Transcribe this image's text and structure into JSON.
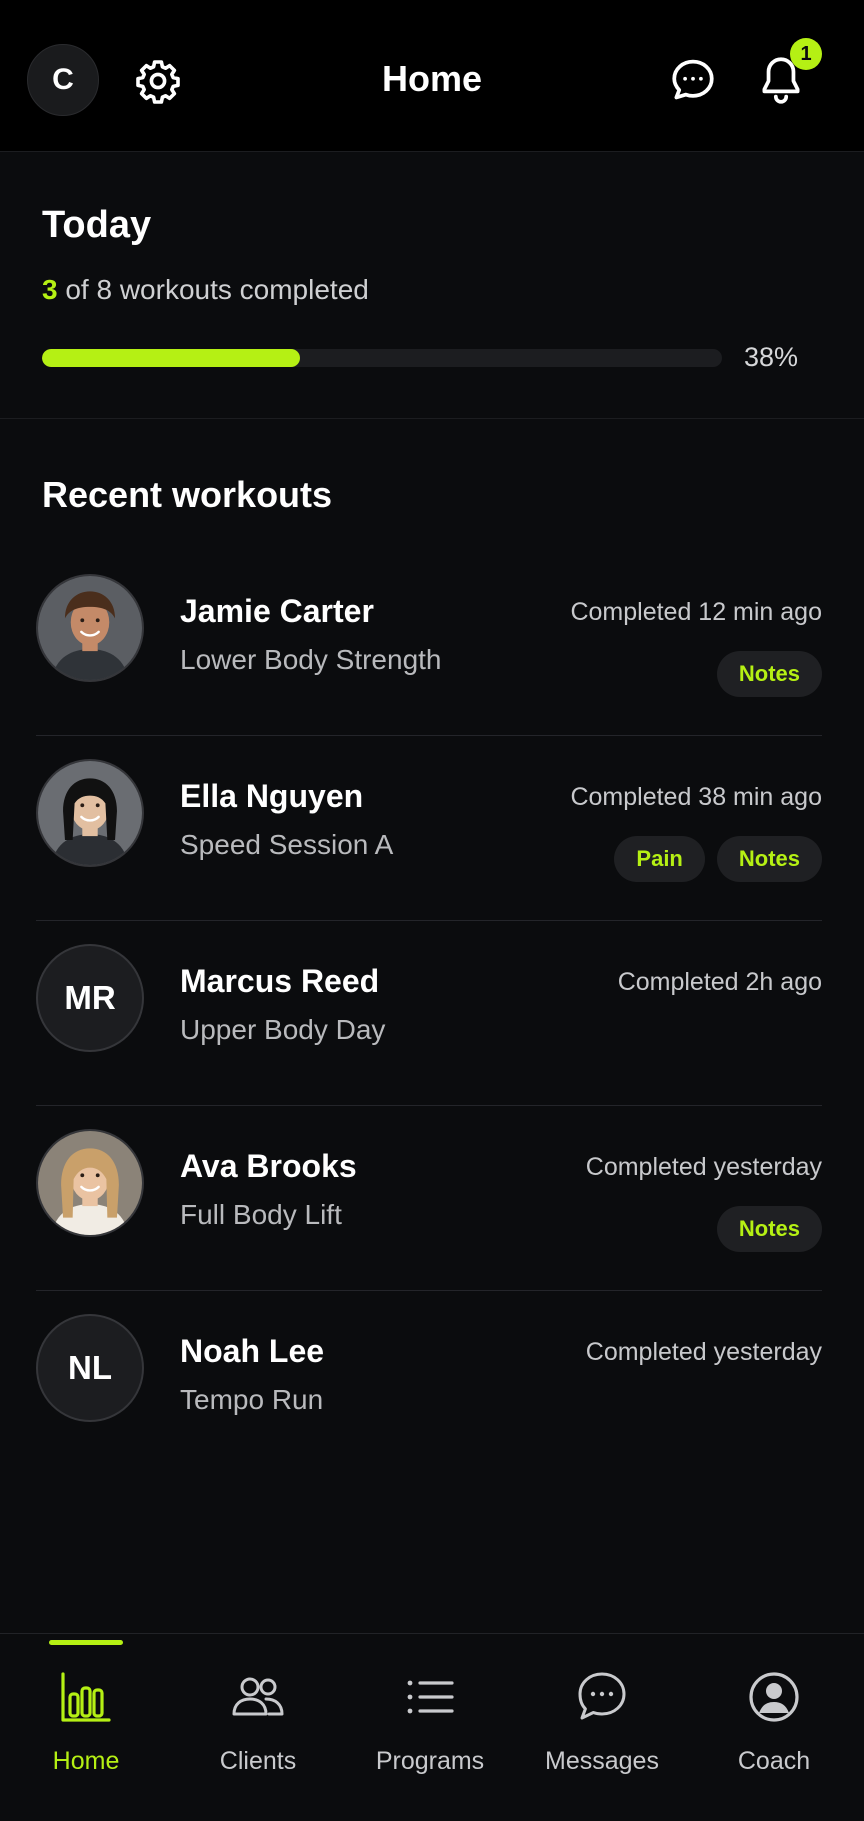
{
  "header": {
    "avatar_initial": "C",
    "title": "Home",
    "notification_count": "1",
    "icons": {
      "settings": "gear-icon",
      "messages": "chat-bubble-icon",
      "notifications": "bell-icon"
    }
  },
  "today": {
    "title": "Today",
    "completed": "3",
    "summary_suffix": " of 8 workouts completed",
    "total": 8,
    "progress_fraction": 0.38,
    "percent_label": "38%"
  },
  "recent": {
    "title": "Recent workouts",
    "items": [
      {
        "name": "Jamie Carter",
        "program": "Lower Body Strength",
        "time": "Completed 12 min ago",
        "avatar": "photo",
        "tags": [
          "Notes"
        ]
      },
      {
        "name": "Ella Nguyen",
        "program": "Speed Session A",
        "time": "Completed 38 min ago",
        "avatar": "photo",
        "tags": [
          "Pain",
          "Notes"
        ]
      },
      {
        "name": "Marcus Reed",
        "program": "Upper Body Day",
        "time": "Completed 2h ago",
        "initials": "MR",
        "tags": []
      },
      {
        "name": "Ava Brooks",
        "program": "Full Body Lift",
        "time": "Completed yesterday",
        "avatar": "photo",
        "tags": [
          "Notes"
        ]
      },
      {
        "name": "Noah Lee",
        "program": "Tempo Run",
        "time": "Completed yesterday",
        "initials": "NL",
        "tags": []
      }
    ]
  },
  "nav": {
    "items": [
      {
        "label": "Home",
        "icon": "bar-chart-icon",
        "active": true
      },
      {
        "label": "Clients",
        "icon": "users-icon",
        "active": false
      },
      {
        "label": "Programs",
        "icon": "list-icon",
        "active": false
      },
      {
        "label": "Messages",
        "icon": "chat-bubble-icon",
        "active": false
      },
      {
        "label": "Coach",
        "icon": "user-circle-icon",
        "active": false
      }
    ]
  },
  "colors": {
    "accent": "#b5f014",
    "background": "#0b0c0e",
    "header": "#000000"
  }
}
